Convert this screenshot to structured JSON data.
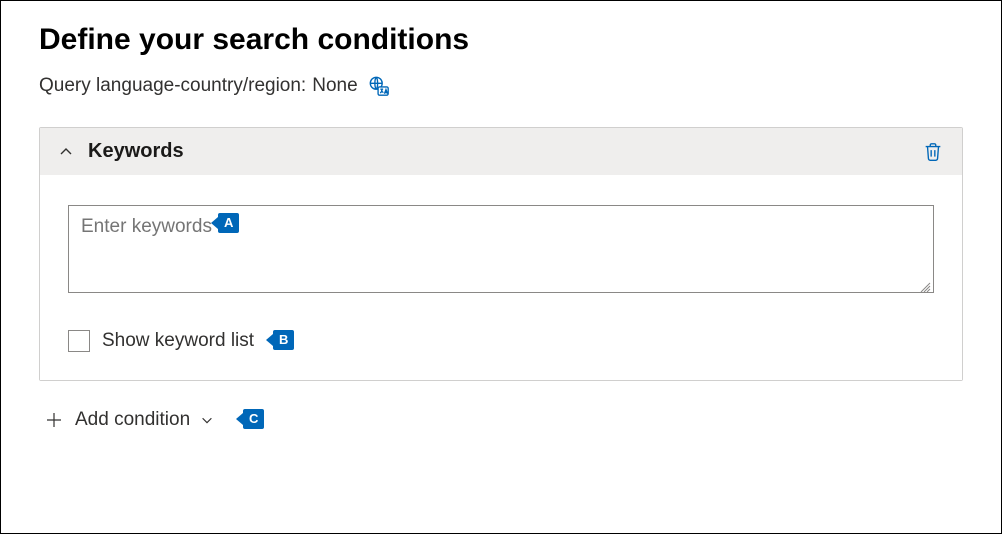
{
  "page": {
    "title": "Define your search conditions",
    "locale_label": "Query language-country/region:",
    "locale_value": "None"
  },
  "panel": {
    "title": "Keywords",
    "textarea_placeholder": "Enter keywords",
    "checkbox_label": "Show keyword list"
  },
  "add_condition": {
    "label": "Add condition"
  },
  "annotations": {
    "a": "A",
    "b": "B",
    "c": "C"
  }
}
